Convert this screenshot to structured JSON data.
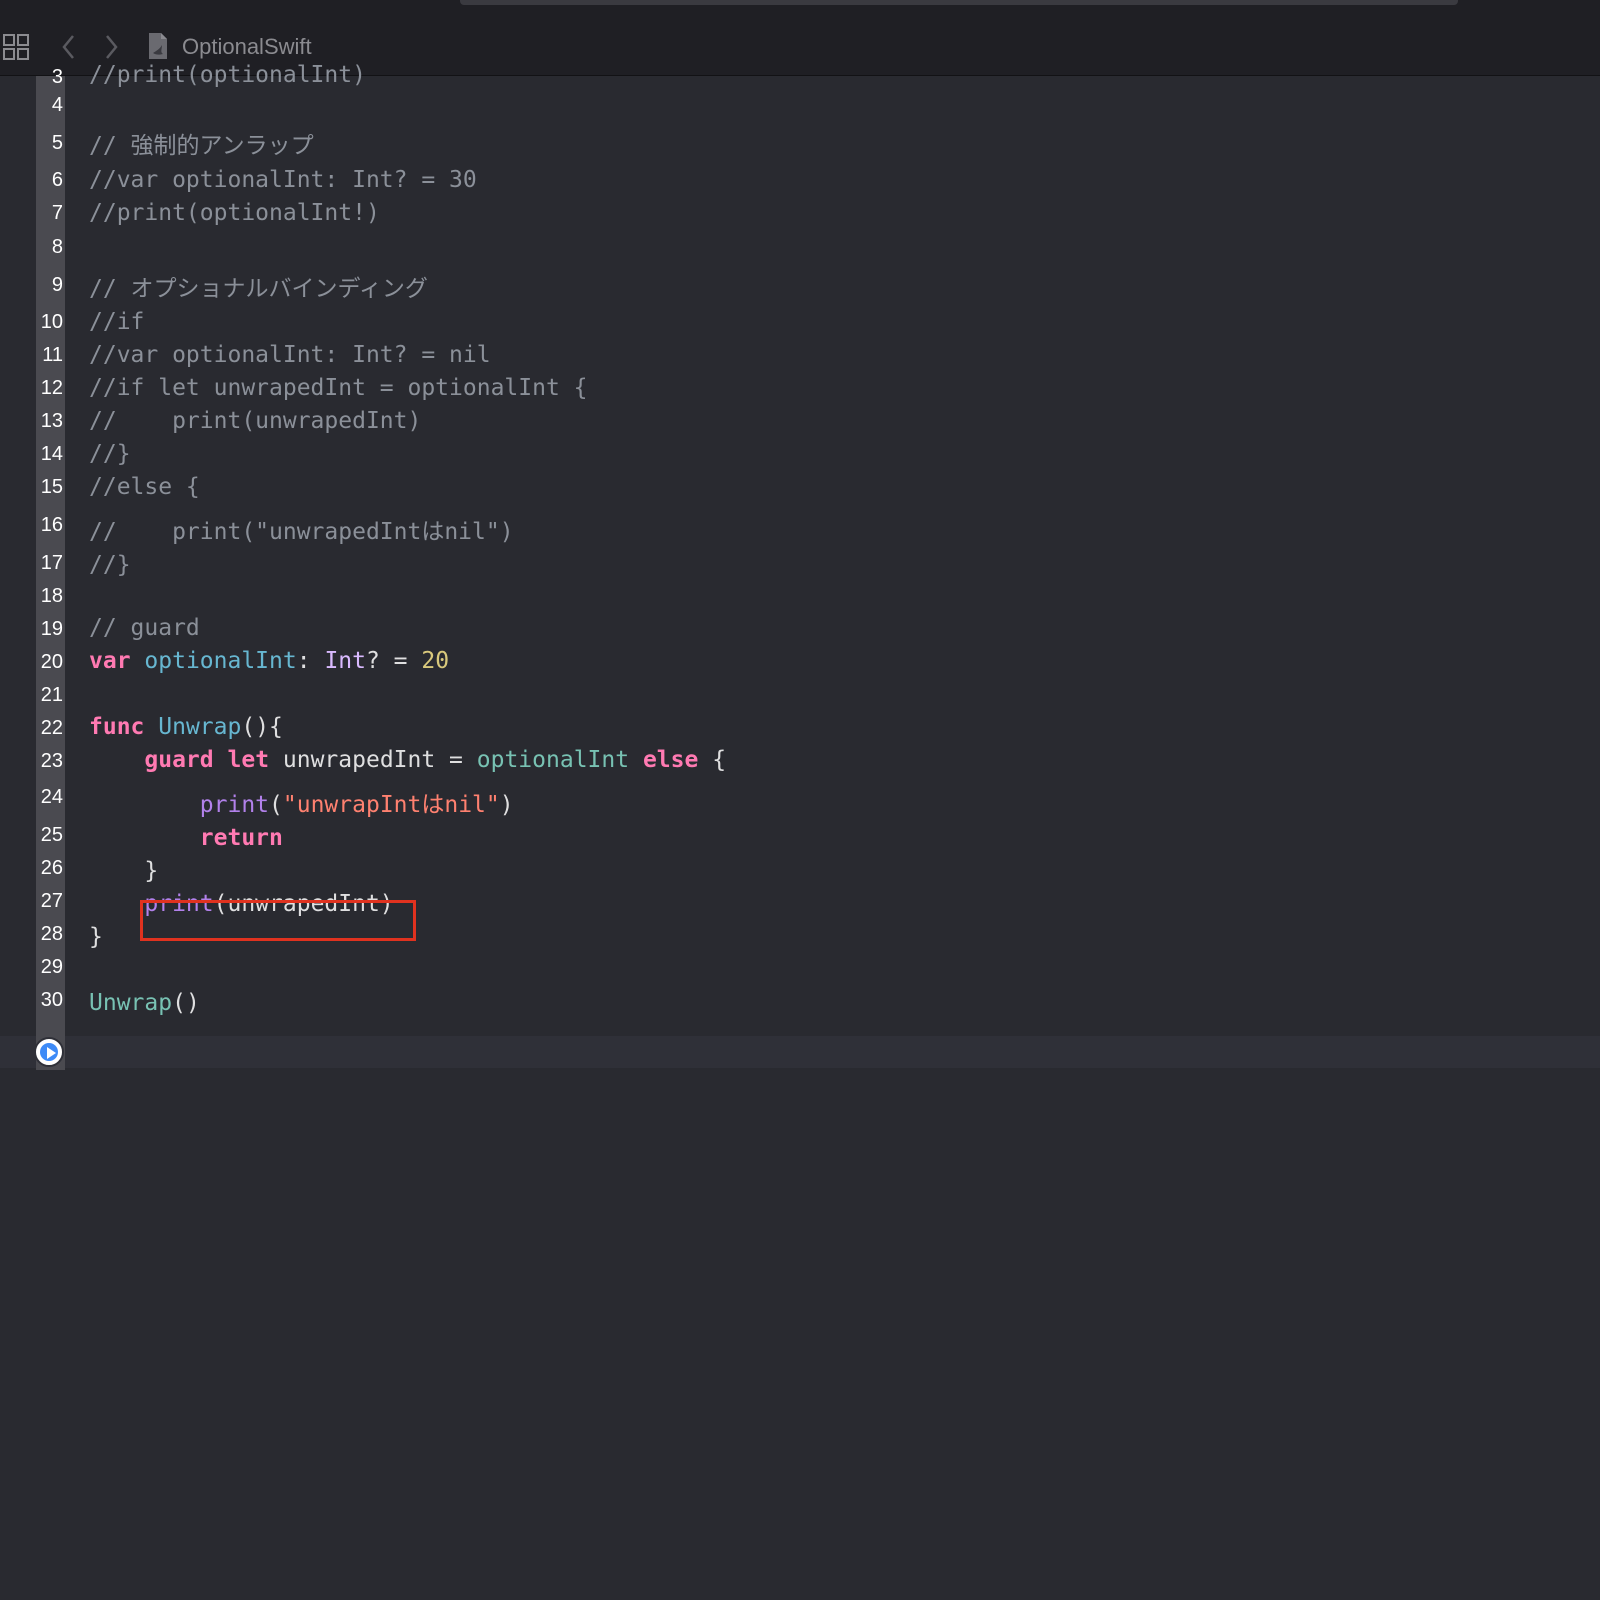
{
  "jumpbar": {
    "file_name": "OptionalSwift",
    "icons": [
      "related-items-grid-icon",
      "chevron-left-icon",
      "chevron-right-icon",
      "swift-file-icon"
    ]
  },
  "editor": {
    "lines": [
      {
        "n": "3",
        "text": "//print(optionalInt)"
      },
      {
        "n": "4",
        "text": ""
      },
      {
        "n": "5",
        "text": "// 強制的アンラップ"
      },
      {
        "n": "6",
        "text": "//var optionalInt: Int? = 30"
      },
      {
        "n": "7",
        "text": "//print(optionalInt!)"
      },
      {
        "n": "8",
        "text": ""
      },
      {
        "n": "9",
        "text": "// オプショナルバインディング"
      },
      {
        "n": "10",
        "text": "//if"
      },
      {
        "n": "11",
        "text": "//var optionalInt: Int? = nil"
      },
      {
        "n": "12",
        "text": "//if let unwrapedInt = optionalInt {"
      },
      {
        "n": "13",
        "text": "//    print(unwrapedInt)"
      },
      {
        "n": "14",
        "text": "//}"
      },
      {
        "n": "15",
        "text": "//else {"
      },
      {
        "n": "16",
        "text": "//    print(\"unwrapedIntはnil\")"
      },
      {
        "n": "17",
        "text": "//}"
      },
      {
        "n": "18",
        "text": ""
      },
      {
        "n": "19",
        "text": "// guard"
      },
      {
        "n": "20",
        "text": "var optionalInt: Int? = 20"
      },
      {
        "n": "21",
        "text": ""
      },
      {
        "n": "22",
        "text": "func Unwrap(){"
      },
      {
        "n": "23",
        "text": "    guard let unwrapedInt = optionalInt else {"
      },
      {
        "n": "24",
        "text": "        print(\"unwrapIntはnil\")"
      },
      {
        "n": "25",
        "text": "        return"
      },
      {
        "n": "26",
        "text": "    }"
      },
      {
        "n": "27",
        "text": "    print(unwrapedInt)"
      },
      {
        "n": "28",
        "text": "}"
      },
      {
        "n": "29",
        "text": ""
      },
      {
        "n": "30",
        "text": "Unwrap()"
      }
    ],
    "highlighted_line": "27",
    "run_button_icon": "play-circle-icon"
  },
  "colors": {
    "background": "#292a30",
    "comment": "#8b9099",
    "keyword": "#ff7ab2",
    "function": "#78c2b3",
    "type": "#dabaff",
    "number": "#d9c97c",
    "string": "#ff8170",
    "highlight_box": "#e0321f",
    "run_button": "#3d8af7"
  }
}
